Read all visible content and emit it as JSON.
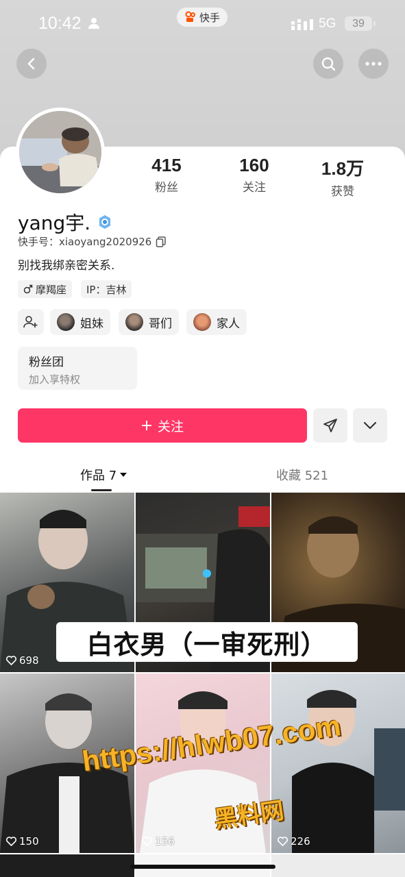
{
  "status_bar": {
    "time": "10:42",
    "app_pill": "快手",
    "network": "5G",
    "battery": "39"
  },
  "profile": {
    "username": "yang宇.",
    "kuaishou_id_label": "快手号：",
    "kuaishou_id": "xiaoyang2020926",
    "bio": "别找我绑亲密关系.",
    "stats": [
      {
        "value": "415",
        "label": "粉丝"
      },
      {
        "value": "160",
        "label": "关注"
      },
      {
        "value": "1.8万",
        "label": "获赞"
      }
    ],
    "tags": [
      {
        "icon": "male-icon",
        "label": "摩羯座"
      },
      {
        "icon": "",
        "label": "IP：吉林"
      }
    ],
    "groups": [
      {
        "label": "姐妹"
      },
      {
        "label": "哥们"
      },
      {
        "label": "家人"
      }
    ],
    "fan_club": {
      "title": "粉丝团",
      "subtitle": "加入享特权"
    },
    "follow_label": "关注"
  },
  "tabs": {
    "works": "作品 7",
    "favorites": "收藏 521"
  },
  "videos": [
    {
      "likes": "698"
    },
    {
      "likes": ""
    },
    {
      "likes": ""
    },
    {
      "likes": "150"
    },
    {
      "likes": "156"
    },
    {
      "likes": "226"
    }
  ],
  "overlay_text": "白衣男（一审死刑）",
  "watermark": {
    "url": "https://hlwb07.com",
    "name": "黑料网"
  },
  "colors": {
    "follow_button": "#fe3666",
    "watermark": "#f6b326"
  }
}
